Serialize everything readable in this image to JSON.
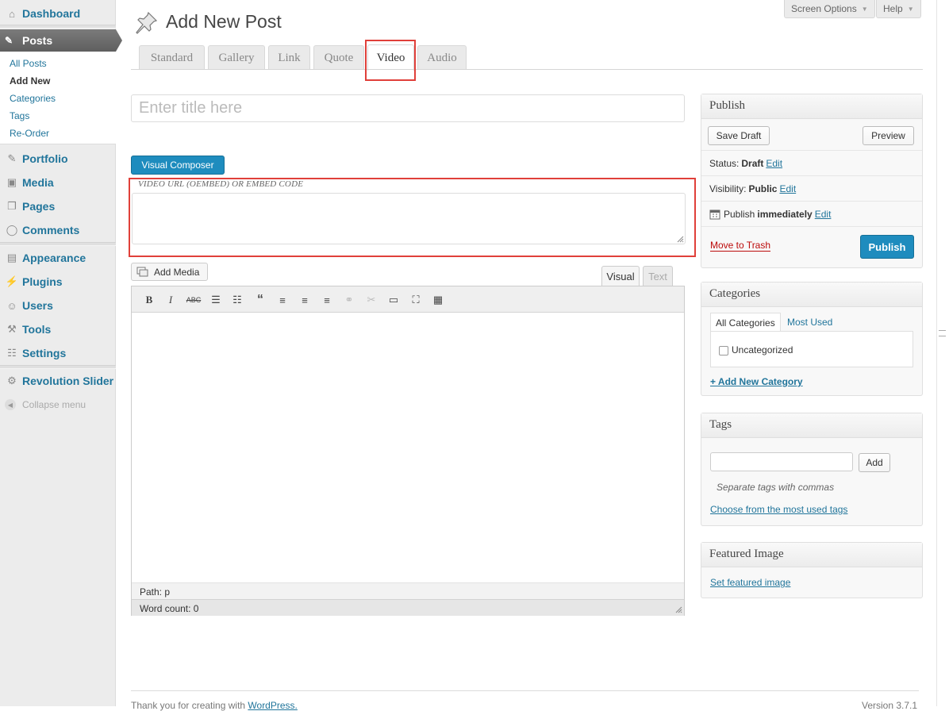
{
  "sidebar": {
    "dashboard": "Dashboard",
    "posts": "Posts",
    "submenu": [
      "All Posts",
      "Add New",
      "Categories",
      "Tags",
      "Re-Order"
    ],
    "portfolio": "Portfolio",
    "media": "Media",
    "pages": "Pages",
    "comments": "Comments",
    "appearance": "Appearance",
    "plugins": "Plugins",
    "users": "Users",
    "tools": "Tools",
    "settings": "Settings",
    "revolution_slider": "Revolution Slider",
    "collapse": "Collapse menu"
  },
  "header": {
    "screen_options": "Screen Options",
    "help": "Help",
    "title": "Add New Post",
    "format_tabs": [
      "Standard",
      "Gallery",
      "Link",
      "Quote",
      "Video",
      "Audio"
    ],
    "active_tab": "Video"
  },
  "main": {
    "title_placeholder": "Enter title here",
    "title_value": "",
    "visual_composer": "Visual Composer",
    "video_label": "VIDEO URL (OEMBED) OR EMBED CODE",
    "video_value": "",
    "add_media": "Add Media",
    "tab_visual": "Visual",
    "tab_text": "Text",
    "path": "Path: p",
    "word_count": "Word count: 0"
  },
  "publish": {
    "title": "Publish",
    "save_draft": "Save Draft",
    "preview": "Preview",
    "status_label": "Status:",
    "status_value": "Draft",
    "visibility_label": "Visibility:",
    "visibility_value": "Public",
    "publish_label": "Publish",
    "publish_value": "immediately",
    "edit": "Edit",
    "move_to_trash": "Move to Trash",
    "publish_button": "Publish"
  },
  "categories": {
    "title": "Categories",
    "tab_all": "All Categories",
    "tab_used": "Most Used",
    "items": [
      "Uncategorized"
    ],
    "add_new": "+ Add New Category"
  },
  "tags": {
    "title": "Tags",
    "add": "Add",
    "help": "Separate tags with commas",
    "choose": "Choose from the most used tags"
  },
  "featured": {
    "title": "Featured Image",
    "set": "Set featured image"
  },
  "footer": {
    "thanks_prefix": "Thank you for creating with ",
    "thanks_link": "WordPress.",
    "version": "Version 3.7.1"
  },
  "colors": {
    "link": "#21759b",
    "primary_button": "#1e8cbe",
    "highlight_box": "#e0403a",
    "trash": "#bc0b0b"
  }
}
